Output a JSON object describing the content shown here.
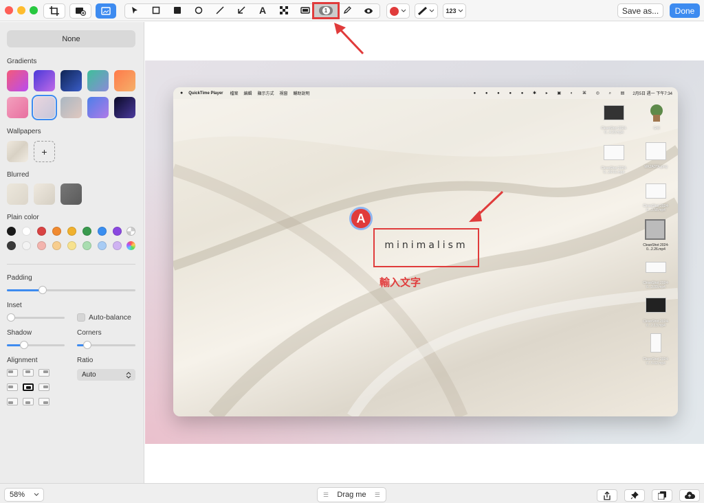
{
  "toolbar": {
    "counter_value": "1",
    "text_size_label": "123",
    "save_as_label": "Save as...",
    "done_label": "Done",
    "colors": {
      "accent": "#3d8bf0",
      "stroke": "#e03b3b",
      "highlight": "#e03b3b"
    },
    "tools": [
      "crop-icon",
      "add-image-icon",
      "background-icon",
      "pointer-icon",
      "rectangle-icon",
      "filled-rectangle-icon",
      "ellipse-icon",
      "line-icon",
      "arrow-icon",
      "text-icon",
      "pixelate-icon",
      "highlight-icon",
      "counter-icon",
      "pencil-icon",
      "blur-icon"
    ]
  },
  "sidebar": {
    "none_label": "None",
    "gradients_label": "Gradients",
    "wallpapers_label": "Wallpapers",
    "blurred_label": "Blurred",
    "plain_color_label": "Plain color",
    "add_label": "+",
    "padding_label": "Padding",
    "inset_label": "Inset",
    "auto_balance_label": "Auto-balance",
    "shadow_label": "Shadow",
    "corners_label": "Corners",
    "alignment_label": "Alignment",
    "ratio_label": "Ratio",
    "ratio_value": "Auto",
    "padding_value": 0.28,
    "inset_value": 0.0,
    "shadow_value": 0.3,
    "corners_value": 0.18,
    "gradients": [
      [
        "#f35a7a",
        "#b84cf0"
      ],
      [
        "#4a3ad8",
        "#c06ae8"
      ],
      [
        "#0f2554",
        "#3a5dc8"
      ],
      [
        "#3fbf9a",
        "#8a8ad8"
      ],
      [
        "#ff7a4a",
        "#f5b06a"
      ],
      [
        "#f3a0bd",
        "#e86fa0"
      ],
      [
        "#e9d5de",
        "#c7c7da"
      ],
      [
        "#aab7c2",
        "#e0c8c0"
      ],
      [
        "#4d7fe8",
        "#b07ae8"
      ],
      [
        "#0a0a28",
        "#4b3a9e"
      ]
    ],
    "plain_colors_row1": [
      "#1a1a1a",
      "#ffffff",
      "#d94343",
      "#f08a30",
      "#f0b12e",
      "#3a9a4e",
      "#3a8ef0",
      "#8a48e0"
    ],
    "plain_colors_row2": [
      "#3a3a3a",
      "#f3f3f3",
      "#f3b4ae",
      "#f7cd8e",
      "#f7e28e",
      "#a9ddb0",
      "#a8ccf5",
      "#cfb3f2"
    ]
  },
  "canvas": {
    "menubar": {
      "app_name": "QuickTime Player",
      "menus": [
        "檔案",
        "編輯",
        "顯示方式",
        "視窗",
        "輔助說明"
      ],
      "clock": "2月5日 週一 下午7:34"
    },
    "desktop_labels": [
      {
        "name": "CleanShot 2024-0...4.23.mp4"
      },
      {
        "name": "Grill"
      },
      {
        "name": "CleanShot 2024-0...26.01.mp4"
      },
      {
        "name": "MK2A3TA.jpeg"
      },
      {
        "name": "CleanShot 2024-0...3.58.mp4"
      },
      {
        "name": "CleanShot 2024-0...2.26.mp4"
      },
      {
        "name": "CleanShot 2024-0...3.09.mp4"
      },
      {
        "name": "CleanShot 2024-0...2.13.mp4"
      },
      {
        "name": "CleanShot 2024-0...5.02.mp4"
      }
    ],
    "annotation_text": "minimalism",
    "counter_badge": "A",
    "caption": "輸入文字"
  },
  "bottombar": {
    "zoom_label": "58%",
    "drag_label": "Drag me"
  }
}
